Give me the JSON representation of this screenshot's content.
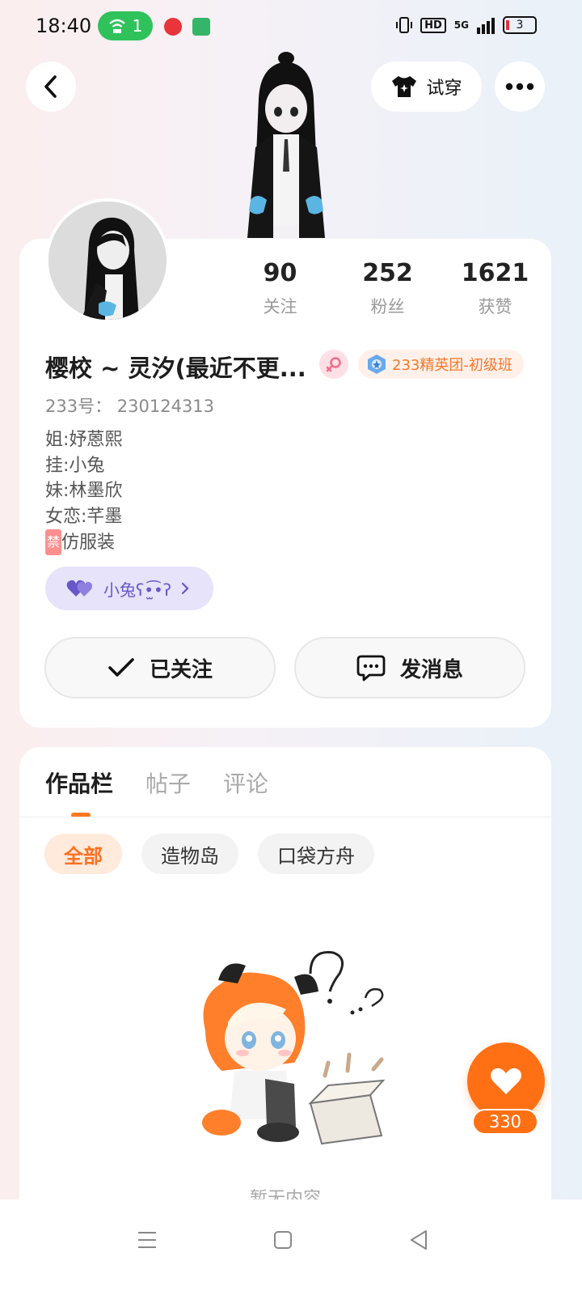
{
  "status_bar": {
    "time": "18:40",
    "hotspot_count": "1",
    "hd_label": "HD",
    "network": "5G",
    "battery": "3"
  },
  "header": {
    "tryon_label": "试穿"
  },
  "profile": {
    "stats": [
      {
        "value": "90",
        "label": "关注"
      },
      {
        "value": "252",
        "label": "粉丝"
      },
      {
        "value": "1621",
        "label": "获赞"
      }
    ],
    "name": "樱校 ~ 灵汐(最近不更...",
    "rank_badge": "233精英团-初级班",
    "uid_label": "233号：",
    "uid": "230124313",
    "bio": [
      "姐:妤蒽熙",
      "挂:小兔",
      "妹:林墨欣",
      "女恋:芊墨"
    ],
    "bio_ban_tag": "禁",
    "bio_last": "仿服装",
    "cp_label": "小兔ʕ•̫͡•ʔ"
  },
  "actions": {
    "follow_label": "已关注",
    "message_label": "发消息"
  },
  "works": {
    "tabs": [
      "作品栏",
      "帖子",
      "评论"
    ],
    "filters": [
      "全部",
      "造物岛",
      "口袋方舟"
    ],
    "empty_text": "暂无内容"
  },
  "like": {
    "count": "330"
  },
  "colors": {
    "accent": "#ff7014",
    "cp_purple": "#6857c8",
    "rank_orange": "#f5782a",
    "wifi_green": "#2fc25b"
  }
}
